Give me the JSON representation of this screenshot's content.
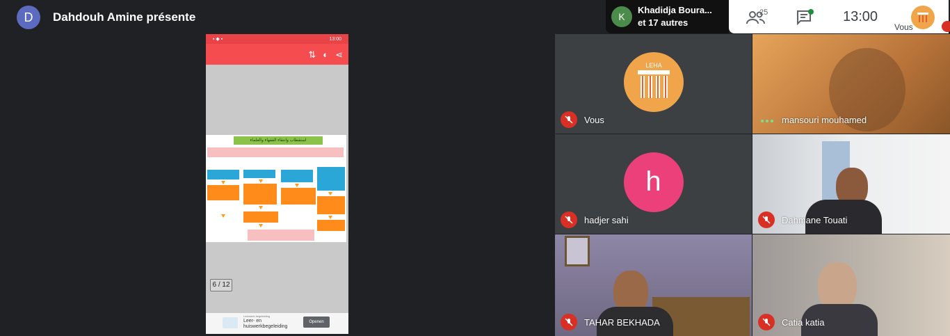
{
  "presenter": {
    "initial": "D",
    "text": "Dahdouh Amine présente",
    "avatar_color": "#5c6bc0"
  },
  "speaker": {
    "initial": "K",
    "line1": "Khadidja Boura...",
    "line2": "et 17 autres",
    "avatar_color": "#4c8c4a"
  },
  "toolbar": {
    "people_count": "25",
    "time": "13:00",
    "self_label": "Vous"
  },
  "phone": {
    "status_time": "13:00",
    "page_indicator": "6 / 12",
    "doc_title": "استقطاب وانتقاء الفقهاء والعلماء",
    "ad_small": "Leerwerk begeleiding",
    "ad_title_1": "Leer- en",
    "ad_title_2": "huiswerkbegeleiding",
    "ad_button": "Openen"
  },
  "tiles": [
    {
      "name": "Vous",
      "type": "logo",
      "bg": "#3c4043",
      "accent": "#f0a54b"
    },
    {
      "name": "mansouri mouhamed",
      "type": "video",
      "bg": "#c98a3c",
      "talking": true
    },
    {
      "name": "hadjer sahi",
      "type": "initial",
      "initial": "h",
      "bg": "#3c4043",
      "accent": "#ec407a"
    },
    {
      "name": "Dahmane Touati",
      "type": "video",
      "bg": "#d9d9d9"
    },
    {
      "name": "TAHAR BEKHADA",
      "type": "video",
      "bg": "#7f6f8c"
    },
    {
      "name": "Catia katia",
      "type": "video",
      "bg": "#8f8a8a"
    }
  ],
  "colors": {
    "mic_off": "#d93025",
    "toolbar_red": "#f44c4f",
    "status_red": "#e84447"
  }
}
